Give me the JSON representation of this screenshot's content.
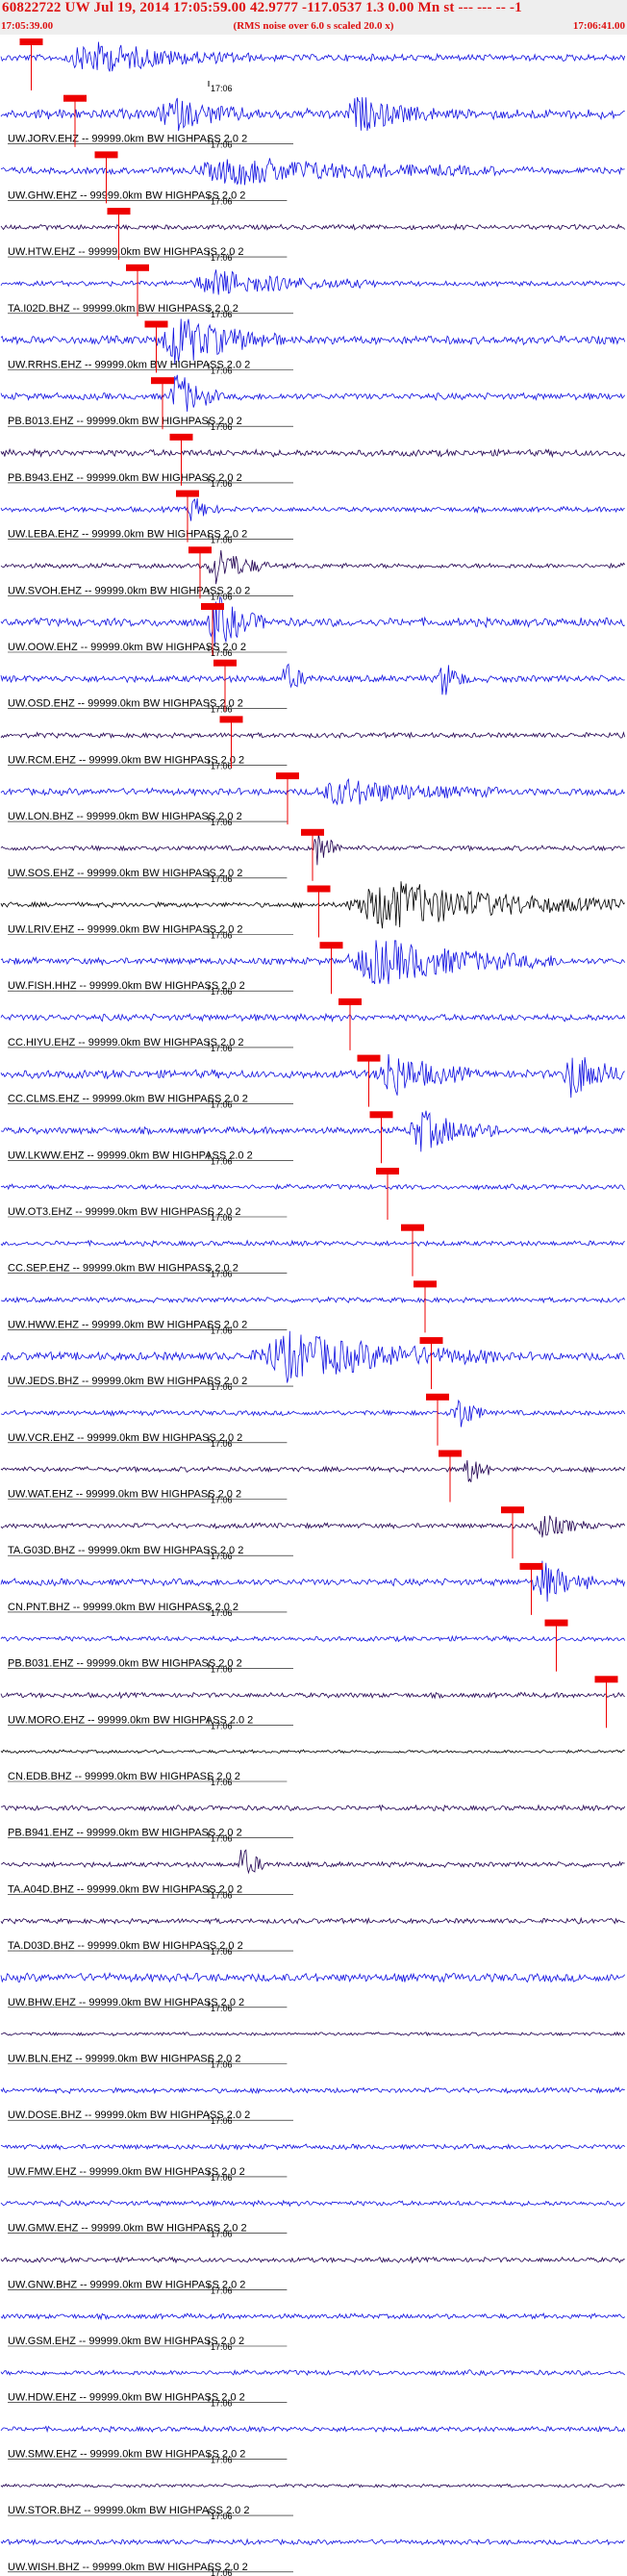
{
  "header": {
    "title": "60822722 UW Jul 19, 2014 17:05:59.00   42.9777 -117.0537  1.3 0.00 Mn st --- --- --  -1",
    "noise_note": "(RMS noise over 6.0 s scaled 20.0 x)",
    "start_time": "17:05:39.00",
    "end_time": "17:06:41.00"
  },
  "chart_data": {
    "type": "line",
    "title": "60822722 UW Jul 19, 2014 17:05:59.00   42.9777 -117.0537  1.3 0.00 Mn st --- --- --  -1",
    "xlim": [
      "17:05:39.00",
      "17:06:41.00"
    ],
    "minute_tick_label": "17:06",
    "colors": {
      "blue": "#1010e0",
      "dark": "#200050",
      "black": "#000000",
      "pick": "#ee0000"
    },
    "traces": [
      {
        "label": "",
        "color": "blue",
        "amp": 4,
        "pick": 0.05,
        "bursts": [
          [
            0.1,
            0.3,
            0.6
          ]
        ]
      },
      {
        "label": "UW.JORV.EHZ -- 99999.0km BW  HIGHPASS  2.0  2",
        "color": "blue",
        "amp": 6,
        "pick": 0.12,
        "bursts": [
          [
            0.25,
            0.15,
            0.6
          ],
          [
            0.55,
            0.15,
            0.6
          ]
        ]
      },
      {
        "label": "UW.GHW.EHZ -- 99999.0km BW  HIGHPASS  2.0  2",
        "color": "blue",
        "amp": 4,
        "pick": 0.17,
        "bursts": [
          [
            0.3,
            0.5,
            0.5
          ]
        ]
      },
      {
        "label": "UW.HTW.EHZ -- 99999.0km BW  HIGHPASS  2.0  2",
        "color": "dark",
        "amp": 3,
        "pick": 0.19,
        "bursts": []
      },
      {
        "label": "TA.I02D.BHZ -- 99999.0km BW  HIGHPASS  2.0  2",
        "color": "blue",
        "amp": 3,
        "pick": 0.22,
        "bursts": [
          [
            0.3,
            0.3,
            0.5
          ]
        ]
      },
      {
        "label": "UW.RRHS.EHZ -- 99999.0km BW  HIGHPASS  2.0  2",
        "color": "blue",
        "amp": 5,
        "pick": 0.25,
        "bursts": [
          [
            0.25,
            0.2,
            1.0
          ]
        ]
      },
      {
        "label": "PB.B013.EHZ -- 99999.0km BW  HIGHPASS  2.0  2",
        "color": "blue",
        "amp": 4,
        "pick": 0.26,
        "bursts": [
          [
            0.27,
            0.08,
            1.0
          ]
        ]
      },
      {
        "label": "PB.B943.EHZ -- 99999.0km BW  HIGHPASS  2.0  2",
        "color": "dark",
        "amp": 4,
        "pick": 0.29,
        "bursts": []
      },
      {
        "label": "UW.LEBA.EHZ -- 99999.0km BW  HIGHPASS  2.0  2",
        "color": "blue",
        "amp": 3,
        "pick": 0.3,
        "bursts": [
          [
            0.3,
            0.05,
            0.6
          ]
        ]
      },
      {
        "label": "UW.SVOH.EHZ -- 99999.0km BW  HIGHPASS  2.0  2",
        "color": "dark",
        "amp": 3,
        "pick": 0.32,
        "bursts": [
          [
            0.33,
            0.1,
            0.8
          ]
        ]
      },
      {
        "label": "UW.OOW.EHZ -- 99999.0km BW  HIGHPASS  2.0  2",
        "color": "blue",
        "amp": 5,
        "pick": 0.34,
        "bursts": [
          [
            0.33,
            0.1,
            1.0
          ]
        ]
      },
      {
        "label": "UW.OSD.EHZ -- 99999.0km BW  HIGHPASS  2.0  2",
        "color": "blue",
        "amp": 4,
        "pick": 0.36,
        "bursts": [
          [
            0.45,
            0.05,
            0.6
          ],
          [
            0.7,
            0.05,
            0.8
          ]
        ]
      },
      {
        "label": "UW.RCM.EHZ -- 99999.0km BW  HIGHPASS  2.0  2",
        "color": "dark",
        "amp": 3,
        "pick": 0.37,
        "bursts": []
      },
      {
        "label": "UW.LON.BHZ -- 99999.0km BW  HIGHPASS  2.0  2",
        "color": "blue",
        "amp": 4,
        "pick": 0.46,
        "bursts": [
          [
            0.5,
            0.3,
            0.5
          ]
        ]
      },
      {
        "label": "UW.SOS.EHZ -- 99999.0km BW  HIGHPASS  2.0  2",
        "color": "dark",
        "amp": 3,
        "pick": 0.5,
        "bursts": [
          [
            0.5,
            0.05,
            0.8
          ]
        ]
      },
      {
        "label": "UW.LRIV.EHZ -- 99999.0km BW  HIGHPASS  2.0  2",
        "color": "black",
        "amp": 3,
        "pick": 0.51,
        "bursts": [
          [
            0.55,
            0.45,
            1.0
          ]
        ]
      },
      {
        "label": "UW.FISH.HHZ -- 99999.0km BW  HIGHPASS  2.0  2",
        "color": "blue",
        "amp": 4,
        "pick": 0.53,
        "bursts": [
          [
            0.55,
            0.35,
            0.9
          ]
        ]
      },
      {
        "label": "CC.HIYU.EHZ -- 99999.0km BW  HIGHPASS  2.0  2",
        "color": "blue",
        "amp": 4,
        "pick": 0.56,
        "bursts": []
      },
      {
        "label": "CC.CLMS.EHZ -- 99999.0km BW  HIGHPASS  2.0  2",
        "color": "blue",
        "amp": 5,
        "pick": 0.59,
        "bursts": [
          [
            0.6,
            0.15,
            0.9
          ],
          [
            0.9,
            0.1,
            1.0
          ]
        ]
      },
      {
        "label": "UW.LKWW.EHZ -- 99999.0km BW  HIGHPASS  2.0  2",
        "color": "blue",
        "amp": 4,
        "pick": 0.61,
        "bursts": [
          [
            0.65,
            0.15,
            0.8
          ]
        ]
      },
      {
        "label": "UW.OT3.EHZ -- 99999.0km BW  HIGHPASS  2.0  2",
        "color": "blue",
        "amp": 3,
        "pick": 0.62,
        "bursts": []
      },
      {
        "label": "CC.SEP.EHZ -- 99999.0km BW  HIGHPASS  2.0  2",
        "color": "blue",
        "amp": 3,
        "pick": 0.66,
        "bursts": []
      },
      {
        "label": "UW.HWW.EHZ -- 99999.0km BW  HIGHPASS  2.0  2",
        "color": "blue",
        "amp": 3,
        "pick": 0.68,
        "bursts": []
      },
      {
        "label": "UW.JEDS.BHZ -- 99999.0km BW  HIGHPASS  2.0  2",
        "color": "blue",
        "amp": 5,
        "pick": 0.69,
        "bursts": [
          [
            0.4,
            0.4,
            0.9
          ]
        ]
      },
      {
        "label": "UW.VCR.EHZ -- 99999.0km BW  HIGHPASS  2.0  2",
        "color": "blue",
        "amp": 3,
        "pick": 0.7,
        "bursts": [
          [
            0.72,
            0.06,
            0.8
          ]
        ]
      },
      {
        "label": "UW.WAT.EHZ -- 99999.0km BW  HIGHPASS  2.0  2",
        "color": "dark",
        "amp": 3,
        "pick": 0.72,
        "bursts": [
          [
            0.74,
            0.05,
            0.7
          ]
        ]
      },
      {
        "label": "TA.G03D.BHZ -- 99999.0km BW  HIGHPASS  2.0  2",
        "color": "dark",
        "amp": 3,
        "pick": 0.82,
        "bursts": [
          [
            0.85,
            0.1,
            0.5
          ]
        ]
      },
      {
        "label": "CN.PNT.BHZ -- 99999.0km BW  HIGHPASS  2.0  2",
        "color": "blue",
        "amp": 4,
        "pick": 0.85,
        "bursts": [
          [
            0.85,
            0.1,
            0.9
          ]
        ]
      },
      {
        "label": "PB.B031.EHZ -- 99999.0km BW  HIGHPASS  2.0  2",
        "color": "blue",
        "amp": 3,
        "pick": 0.89,
        "bursts": []
      },
      {
        "label": "UW.MORO.EHZ -- 99999.0km BW  HIGHPASS  2.0  2",
        "color": "dark",
        "amp": 3,
        "pick": 0.97,
        "bursts": []
      },
      {
        "label": "CN.EDB.BHZ -- 99999.0km BW  HIGHPASS  2.0  2",
        "color": "black",
        "amp": 2,
        "bursts": []
      },
      {
        "label": "PB.B941.EHZ -- 99999.0km BW  HIGHPASS  2.0  2",
        "color": "dark",
        "amp": 3,
        "bursts": []
      },
      {
        "label": "TA.A04D.BHZ -- 99999.0km BW  HIGHPASS  2.0  2",
        "color": "dark",
        "amp": 3,
        "bursts": [
          [
            0.38,
            0.05,
            0.7
          ]
        ]
      },
      {
        "label": "TA.D03D.BHZ -- 99999.0km BW  HIGHPASS  2.0  2",
        "color": "dark",
        "amp": 3,
        "bursts": []
      },
      {
        "label": "UW.BHW.EHZ -- 99999.0km BW  HIGHPASS  2.0  2",
        "color": "blue",
        "amp": 5,
        "bursts": []
      },
      {
        "label": "UW.BLN.EHZ -- 99999.0km BW  HIGHPASS  2.0  2",
        "color": "dark",
        "amp": 2,
        "bursts": []
      },
      {
        "label": "UW.DOSE.BHZ -- 99999.0km BW  HIGHPASS  2.0  2",
        "color": "blue",
        "amp": 3,
        "bursts": []
      },
      {
        "label": "UW.FMW.EHZ -- 99999.0km BW  HIGHPASS  2.0  2",
        "color": "blue",
        "amp": 3,
        "bursts": []
      },
      {
        "label": "UW.GMW.EHZ -- 99999.0km BW  HIGHPASS  2.0  2",
        "color": "blue",
        "amp": 3,
        "bursts": []
      },
      {
        "label": "UW.GNW.BHZ -- 99999.0km BW  HIGHPASS  2.0  2",
        "color": "dark",
        "amp": 3,
        "bursts": []
      },
      {
        "label": "UW.GSM.EHZ -- 99999.0km BW  HIGHPASS  2.0  2",
        "color": "blue",
        "amp": 3,
        "bursts": []
      },
      {
        "label": "UW.HDW.EHZ -- 99999.0km BW  HIGHPASS  2.0  2",
        "color": "blue",
        "amp": 3,
        "bursts": []
      },
      {
        "label": "UW.SMW.EHZ -- 99999.0km BW  HIGHPASS  2.0  2",
        "color": "blue",
        "amp": 3,
        "bursts": []
      },
      {
        "label": "UW.STOR.BHZ -- 99999.0km BW  HIGHPASS  2.0  2",
        "color": "dark",
        "amp": 2,
        "bursts": []
      },
      {
        "label": "UW.WISH.BHZ -- 99999.0km BW  HIGHPASS  2.0  2",
        "color": "blue",
        "amp": 3,
        "bursts": []
      }
    ]
  }
}
